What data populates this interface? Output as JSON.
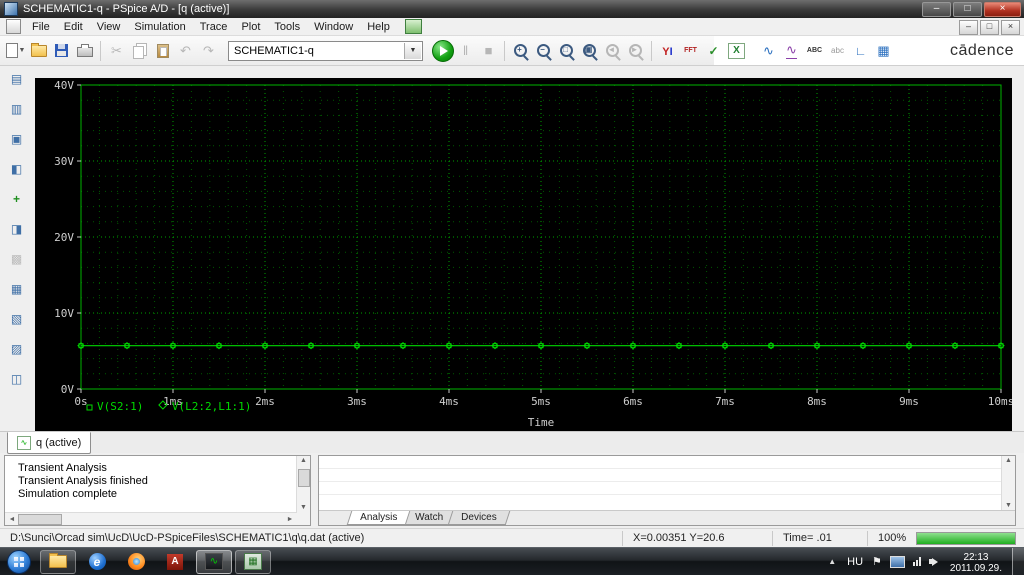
{
  "titlebar": {
    "title": "SCHEMATIC1-q - PSpice A/D  - [q (active)]"
  },
  "menubar": {
    "items": [
      "File",
      "Edit",
      "View",
      "Simulation",
      "Trace",
      "Plot",
      "Tools",
      "Window",
      "Help"
    ]
  },
  "toolbar": {
    "profile_value": "SCHEMATIC1-q",
    "brand": "cādence"
  },
  "chart_data": {
    "type": "line",
    "title": "",
    "xlabel": "Time",
    "x_ticks": [
      "0s",
      "1ms",
      "2ms",
      "3ms",
      "4ms",
      "5ms",
      "6ms",
      "7ms",
      "8ms",
      "9ms",
      "10ms"
    ],
    "x_tick_values": [
      0,
      1,
      2,
      3,
      4,
      5,
      6,
      7,
      8,
      9,
      10
    ],
    "x_unit": "ms",
    "y_ticks": [
      "40V",
      "30V",
      "20V",
      "10V",
      "0V"
    ],
    "y_tick_values": [
      40,
      30,
      20,
      10,
      0
    ],
    "xlim": [
      0,
      10
    ],
    "ylim": [
      0,
      40
    ],
    "grid": true,
    "background_color": "#000000",
    "major_grid_color": "#00a000",
    "minor_grid_color": "#005800",
    "frame_color": "#00b400",
    "axis_text_color": "#cfcfcf",
    "series": [
      {
        "name": "V(S2:1)",
        "marker": "square",
        "color": "#00d800",
        "y_constant": 5.7,
        "marker_step": 0.5
      },
      {
        "name": "V(L2:2,L1:1)",
        "marker": "diamond",
        "color": "#00d800",
        "y_constant": 5.7,
        "marker_step": 0.5
      }
    ]
  },
  "doc_tab": {
    "label": "q (active)"
  },
  "output_window": {
    "lines": [
      "Transient Analysis",
      "Transient Analysis finished",
      "Simulation complete"
    ]
  },
  "sim_panel": {
    "tabs": [
      "Analysis",
      "Watch",
      "Devices"
    ]
  },
  "statusbar": {
    "file_path": "D:\\Sunci\\Orcad sim\\UcD\\UcD-PSpiceFiles\\SCHEMATIC1\\q\\q.dat (active)",
    "cursor": "X=0.00351 Y=20.6",
    "sim_time": "Time= .01",
    "progress": "100%"
  },
  "taskbar": {
    "language": "HU",
    "clock_time": "22:13",
    "clock_date": "2011.09.29."
  }
}
